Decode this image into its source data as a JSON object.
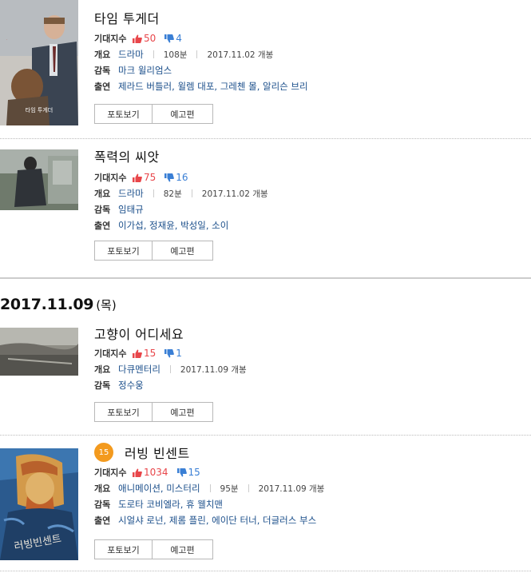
{
  "movies": [
    {
      "title": "타임 투게더",
      "age": "",
      "expect_label": "기대지수",
      "likes": "50",
      "dislikes": "4",
      "outline_label": "개요",
      "genre": "드라마",
      "runtime": "108분",
      "release": "2017.11.02 개봉",
      "director_label": "감독",
      "director": "마크 윌리엄스",
      "cast_label": "출연",
      "cast": "제라드 버틀러, 윌렘 대포, 그레첸 몰, 알리슨 브리",
      "poster_text": "타임 투게더",
      "photo_btn": "포토보기",
      "trailer_btn": "예고편"
    },
    {
      "title": "폭력의 씨앗",
      "age": "",
      "expect_label": "기대지수",
      "likes": "75",
      "dislikes": "16",
      "outline_label": "개요",
      "genre": "드라마",
      "runtime": "82분",
      "release": "2017.11.02 개봉",
      "director_label": "감독",
      "director": "임태규",
      "cast_label": "출연",
      "cast": "이가섭, 정재윤, 박성일, 소이",
      "photo_btn": "포토보기",
      "trailer_btn": "예고편"
    },
    {
      "title": "고향이 어디세요",
      "age": "",
      "expect_label": "기대지수",
      "likes": "15",
      "dislikes": "1",
      "outline_label": "개요",
      "genre": "다큐멘터리",
      "release": "2017.11.09 개봉",
      "director_label": "감독",
      "director": "정수웅",
      "photo_btn": "포토보기",
      "trailer_btn": "예고편"
    },
    {
      "title": "러빙 빈센트",
      "age": "15",
      "expect_label": "기대지수",
      "likes": "1034",
      "dislikes": "15",
      "outline_label": "개요",
      "genre": "애니메이션, 미스터리",
      "runtime": "95분",
      "release": "2017.11.09 개봉",
      "director_label": "감독",
      "director": "도로타 코비엘라, 휴 웰치맨",
      "cast_label": "출연",
      "cast": "시얼샤 로넌, 제롬 플린, 에이단 터너, 더글러스 부스",
      "poster_text": "러빙빈센트",
      "photo_btn": "포토보기",
      "trailer_btn": "예고편"
    }
  ],
  "date_section": {
    "date": "2017.11.09",
    "weekday": "(목)"
  },
  "colors": {
    "like": "#e8464a",
    "dislike": "#3a7fd5",
    "link": "#1a4e8a",
    "age_badge": "#f39a1e"
  }
}
